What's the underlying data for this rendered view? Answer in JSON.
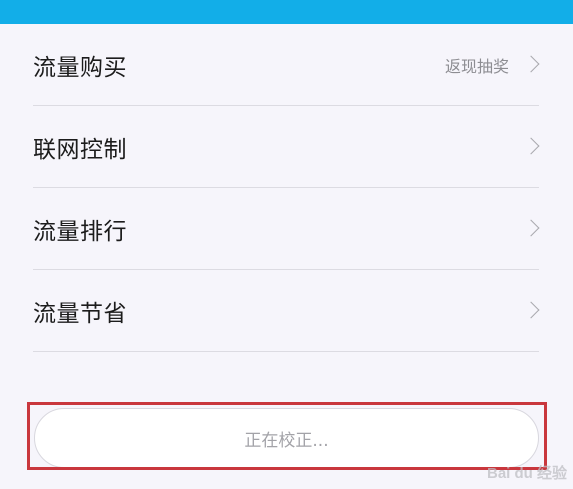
{
  "menu": {
    "items": [
      {
        "label": "流量购买",
        "hint": "返现抽奖"
      },
      {
        "label": "联网控制",
        "hint": ""
      },
      {
        "label": "流量排行",
        "hint": ""
      },
      {
        "label": "流量节省",
        "hint": ""
      }
    ]
  },
  "calibration": {
    "status": "正在校正..."
  },
  "watermark": {
    "text": "Bai du 经验"
  },
  "colors": {
    "top_bar": "#12aee8",
    "highlight_border": "#c9373d",
    "background": "#f6f5fb"
  }
}
